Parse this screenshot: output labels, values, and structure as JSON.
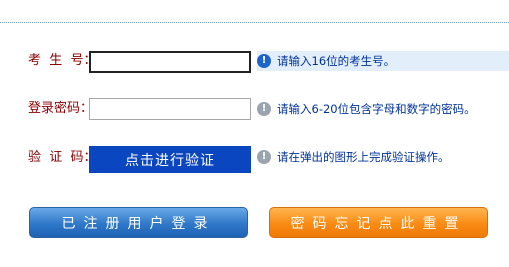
{
  "form": {
    "exam_no": {
      "label": "考  生  号：",
      "value": "",
      "hint": "请输入16位的考生号。"
    },
    "password": {
      "label": "登录密码：",
      "value": "",
      "hint": "请输入6-20位包含字母和数字的密码。"
    },
    "captcha": {
      "label": "验  证  码：",
      "button": "点击进行验证",
      "hint": "请在弹出的图形上完成验证操作。"
    }
  },
  "actions": {
    "login": "已注册用户登录",
    "forgot": "密码忘记点此重置"
  },
  "colors": {
    "label": "#8b0000",
    "hint": "#003399",
    "verify_button": "#0a46c0",
    "login_button": "#2f78c9",
    "reset_button": "#f98b14"
  },
  "icons": {
    "active_hint": "info-icon",
    "inactive_hint": "info-icon"
  }
}
